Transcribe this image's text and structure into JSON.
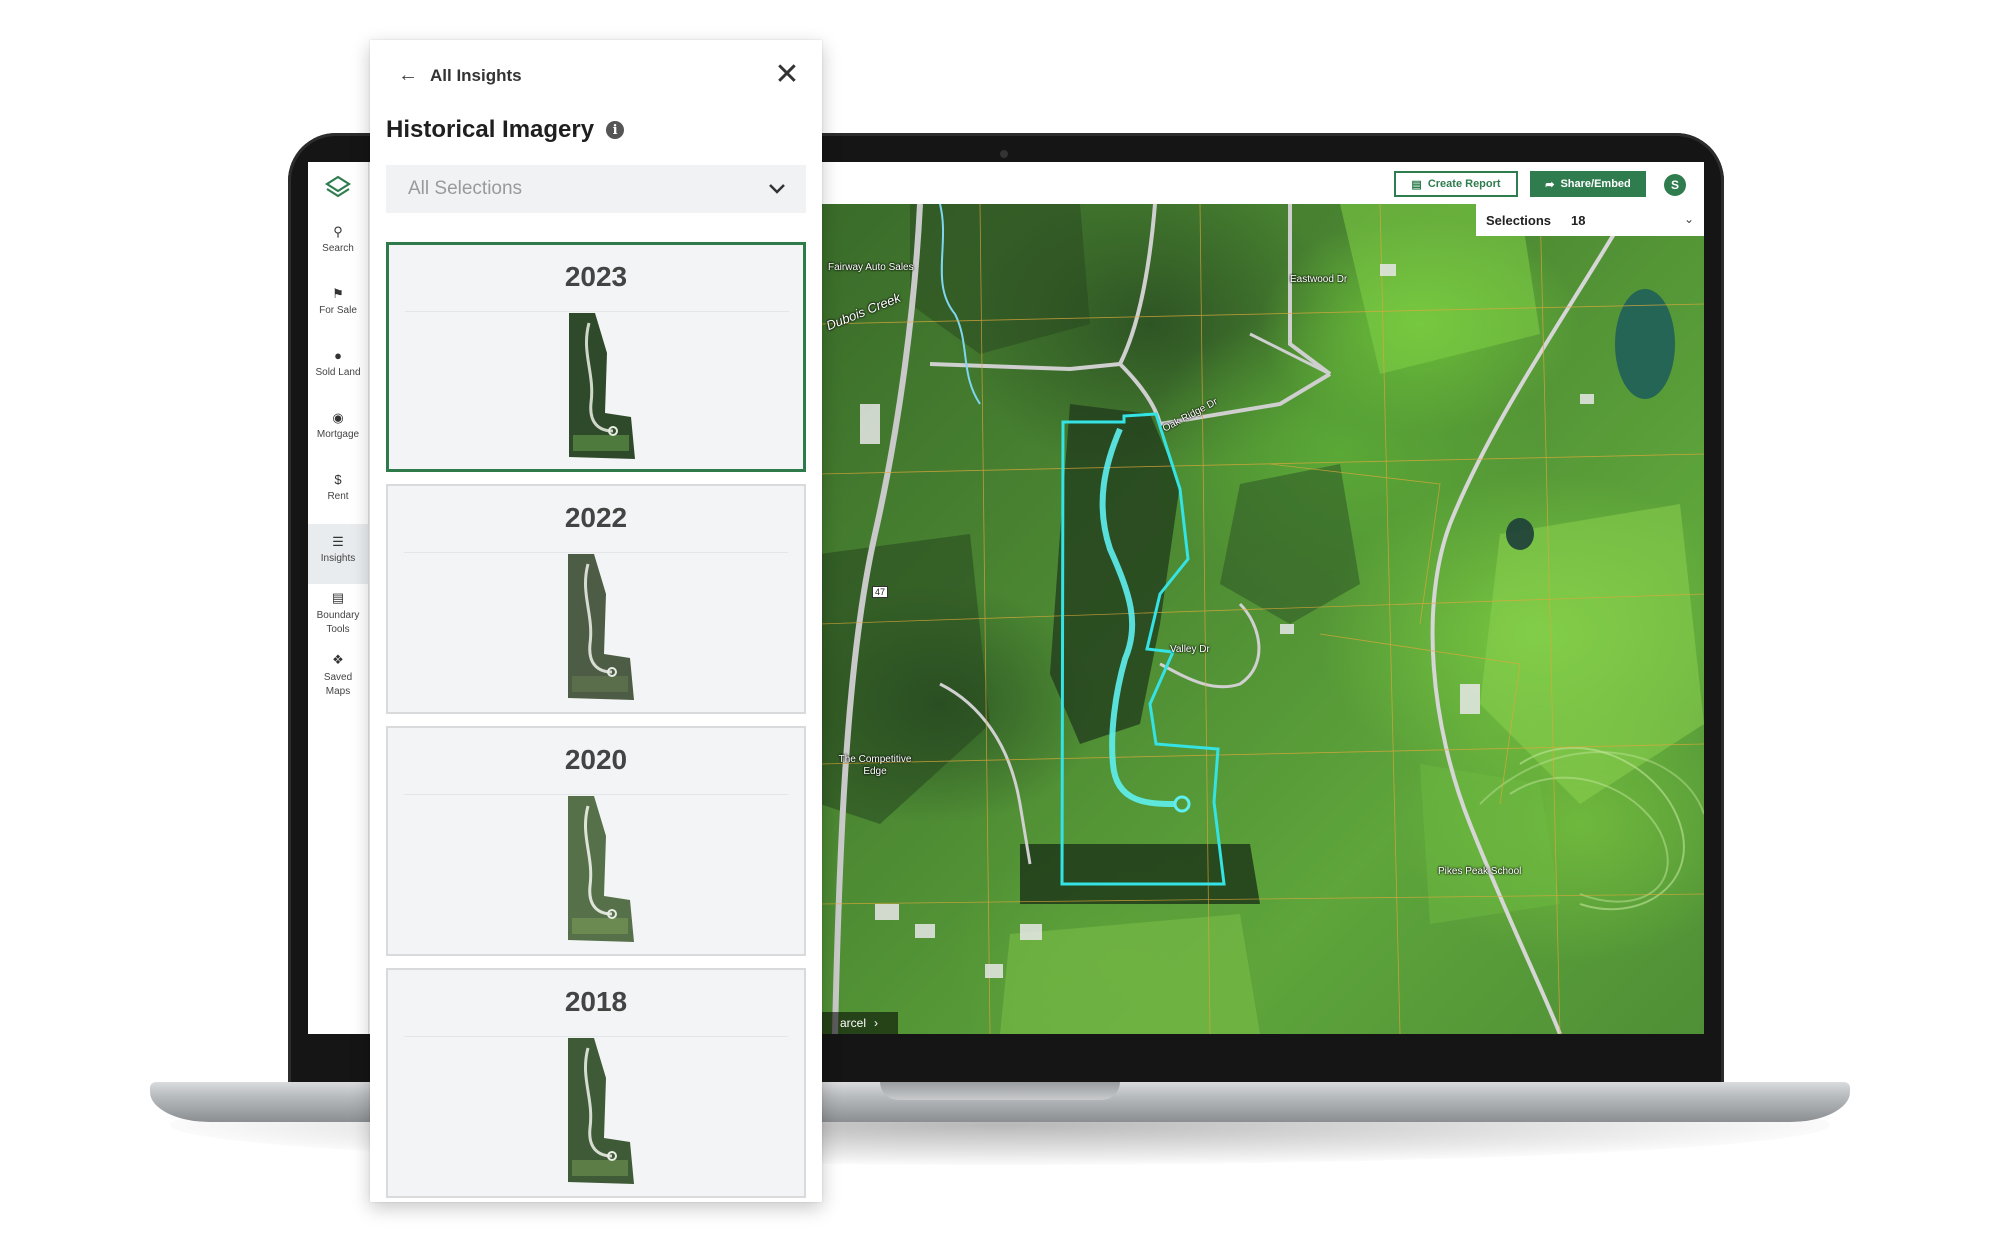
{
  "app": {
    "rail": [
      {
        "label": "Search",
        "icon": "search-icon"
      },
      {
        "label": "For Sale",
        "icon": "flag-icon"
      },
      {
        "label": "Sold Land",
        "icon": "location-pin-icon"
      },
      {
        "label": "Mortgage",
        "icon": "dollar-icon"
      },
      {
        "label": "Rent",
        "icon": "hand-dollar-icon"
      },
      {
        "label": "Insights",
        "icon": "layers-icon",
        "active": true
      },
      {
        "label": "Boundary Tools",
        "icon": "boundary-tools-icon"
      },
      {
        "label": "Saved Maps",
        "icon": "pin-icon"
      }
    ],
    "toolbar": {
      "create_report": "Create Report",
      "share_embed": "Share/Embed",
      "avatar_initial": "S"
    },
    "selections": {
      "label": "Selections",
      "count": "18"
    },
    "map_labels": {
      "fairway": "Fairway Auto Sales",
      "creek": "Dubois Creek",
      "eastwood": "Eastwood Dr",
      "oakridge": "Oak Ridge Dr",
      "valley": "Valley Dr",
      "competitive": "The Competitive Edge",
      "pikes": "Pikes Peak School",
      "route": "47",
      "parcel": "arcel"
    }
  },
  "panel": {
    "back_label": "All Insights",
    "title": "Historical Imagery",
    "select_value": "All Selections",
    "years": [
      "2023",
      "2022",
      "2020",
      "2018"
    ],
    "selected_year": "2023"
  },
  "colors": {
    "brand_green": "#2f7d4e",
    "parcel_outline": "#33e0e0"
  }
}
